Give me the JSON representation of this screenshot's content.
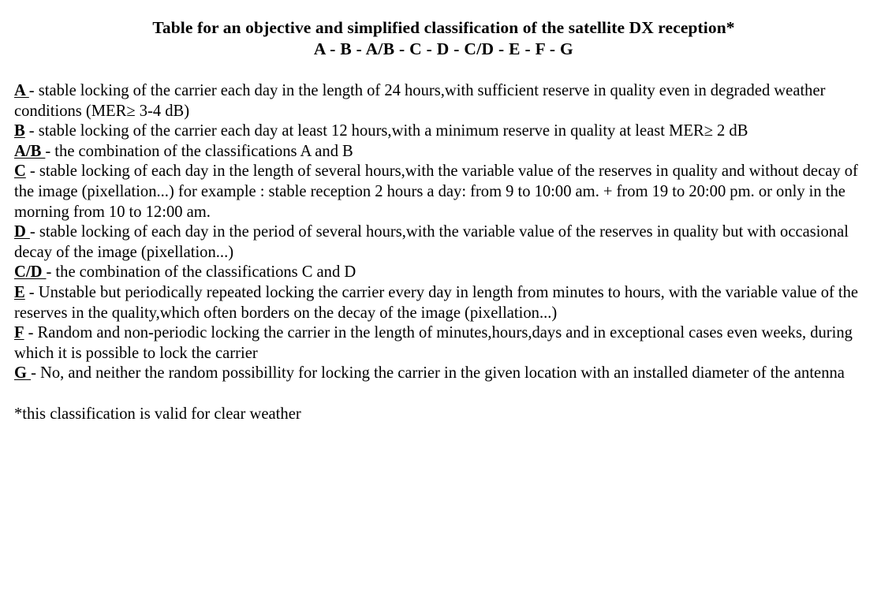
{
  "document": {
    "background_color": "#ffffff",
    "text_color": "#000000",
    "title": {
      "line1": "Table for an objective and simplified classification of the satellite DX reception*",
      "line2": "A - B - A/B - C - D - C/D - E - F - G"
    },
    "entries": [
      {
        "label": "A ",
        "text": "- stable locking of the carrier each day in the length of 24 hours,with sufficient reserve in quality even in degraded weather conditions (MER≥ 3-4 dB)"
      },
      {
        "label": "B",
        "text": " - stable locking of the carrier each day at least 12 hours,with a minimum reserve in quality at least MER≥ 2 dB"
      },
      {
        "label": "A/B ",
        "text": "- the combination of the classifications A and B"
      },
      {
        "label": "C",
        "text": " - stable locking of each day in the length of several hours,with the variable value of the reserves in quality and without decay of the image (pixellation...) for example : stable reception 2 hours a day: from 9 to 10:00 am. + from 19 to 20:00 pm. or only in the morning from 10 to 12:00 am."
      },
      {
        "label": "D ",
        "text": "- stable locking of each day in the period of several hours,with the variable value of the reserves in quality but with occasional decay of the image (pixellation...)"
      },
      {
        "label": "C/D ",
        "text": "- the combination of the classifications C and D"
      },
      {
        "label": "E",
        "text": " - Unstable but periodically repeated locking the carrier every day in length from minutes to hours, with the variable value of the reserves in the quality,which often borders on the decay of the image (pixellation...)"
      },
      {
        "label": "F",
        "text": " - Random and non-periodic locking the carrier in the length of minutes,hours,days and in exceptional cases even weeks, during which it is possible to lock the carrier"
      },
      {
        "label": "G ",
        "text": "- No, and neither the random possibillity for locking the carrier in the given location with an installed diameter of the antenna"
      }
    ],
    "footnote": "*this classification is valid for clear weather"
  }
}
